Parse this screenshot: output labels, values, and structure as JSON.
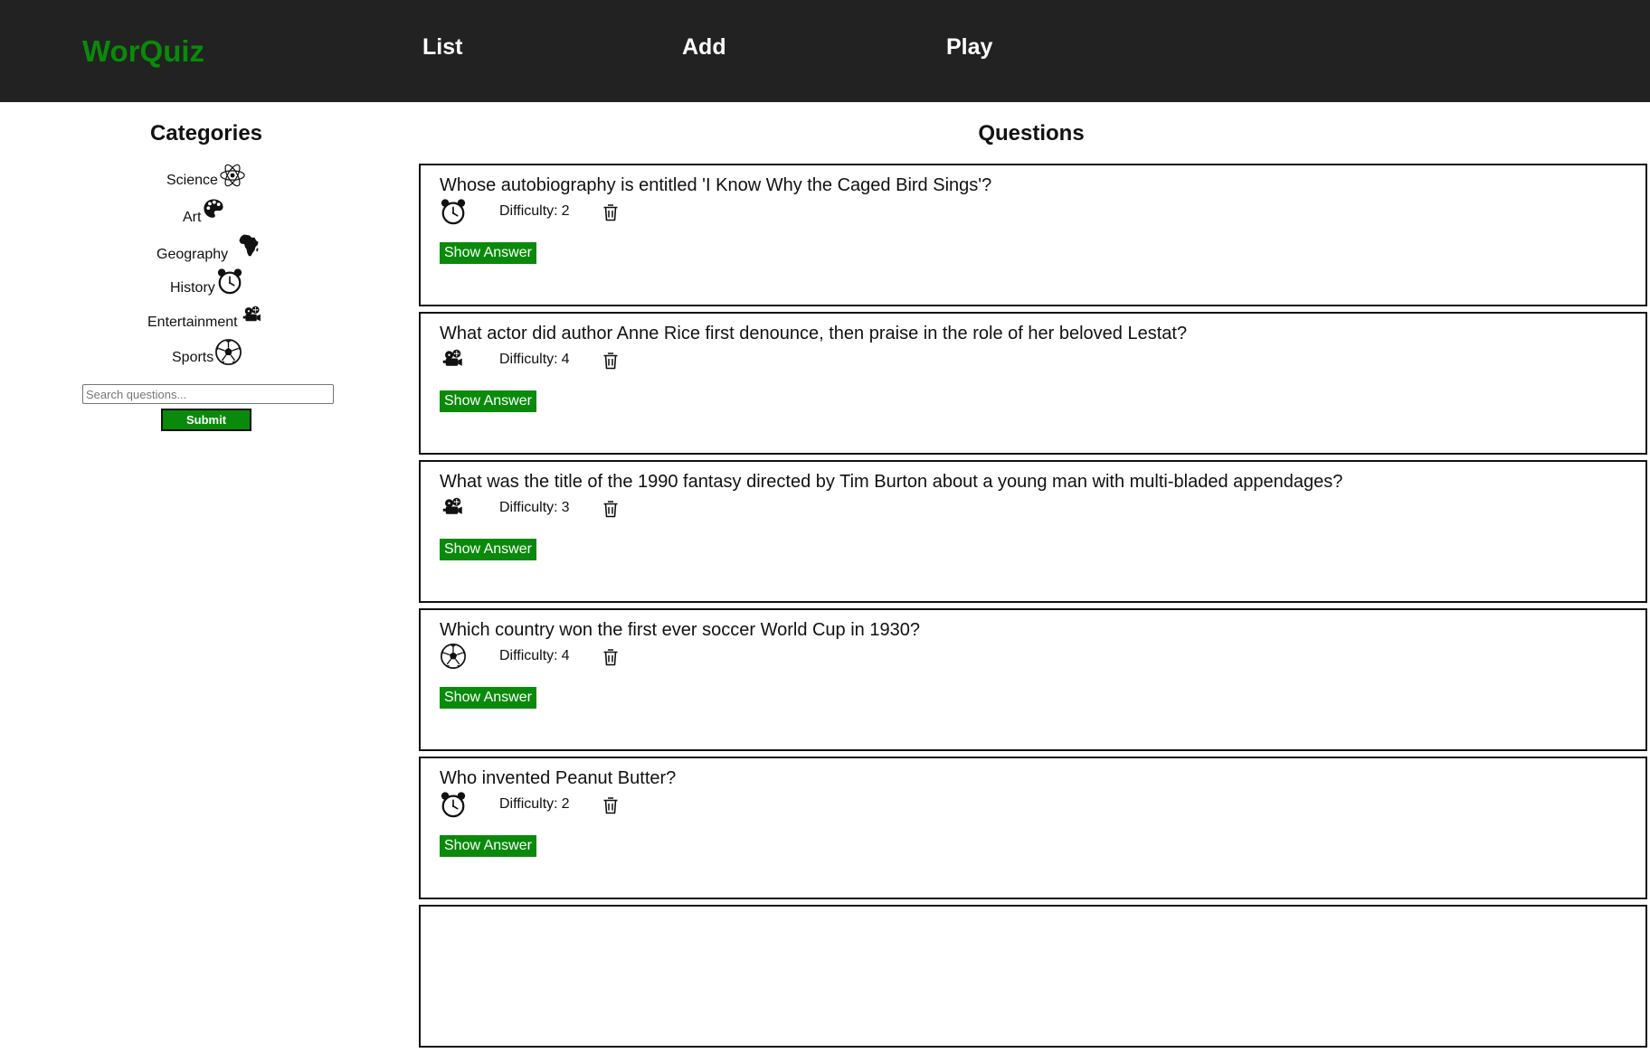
{
  "nav": {
    "brand": "WorQuiz",
    "links": [
      "List",
      "Add",
      "Play"
    ]
  },
  "sidebar": {
    "title": "Categories",
    "categories": [
      {
        "label": "Science",
        "icon": "atom-icon"
      },
      {
        "label": "Art",
        "icon": "palette-icon"
      },
      {
        "label": "Geography",
        "icon": "africa-icon"
      },
      {
        "label": "History",
        "icon": "alarm-clock-icon"
      },
      {
        "label": "Entertainment",
        "icon": "film-camera-icon"
      },
      {
        "label": "Sports",
        "icon": "soccer-ball-icon"
      }
    ],
    "search_placeholder": "Search questions...",
    "submit_label": "Submit"
  },
  "main": {
    "title": "Questions",
    "difficulty_label": "Difficulty:",
    "show_answer_label": "Show Answer",
    "questions": [
      {
        "text": "Whose autobiography is entitled 'I Know Why the Caged Bird Sings'?",
        "category_icon": "alarm-clock-icon",
        "difficulty": "2"
      },
      {
        "text": "What actor did author Anne Rice first denounce, then praise in the role of her beloved Lestat?",
        "category_icon": "film-camera-icon",
        "difficulty": "4"
      },
      {
        "text": "What was the title of the 1990 fantasy directed by Tim Burton about a young man with multi-bladed appendages?",
        "category_icon": "film-camera-icon",
        "difficulty": "3"
      },
      {
        "text": "Which country won the first ever soccer World Cup in 1930?",
        "category_icon": "soccer-ball-icon",
        "difficulty": "4"
      },
      {
        "text": "Who invented Peanut Butter?",
        "category_icon": "alarm-clock-icon",
        "difficulty": "2"
      }
    ]
  },
  "colors": {
    "navbar_bg": "#222222",
    "brand": "#0a8a0a",
    "button_green": "#0a8a0a"
  }
}
